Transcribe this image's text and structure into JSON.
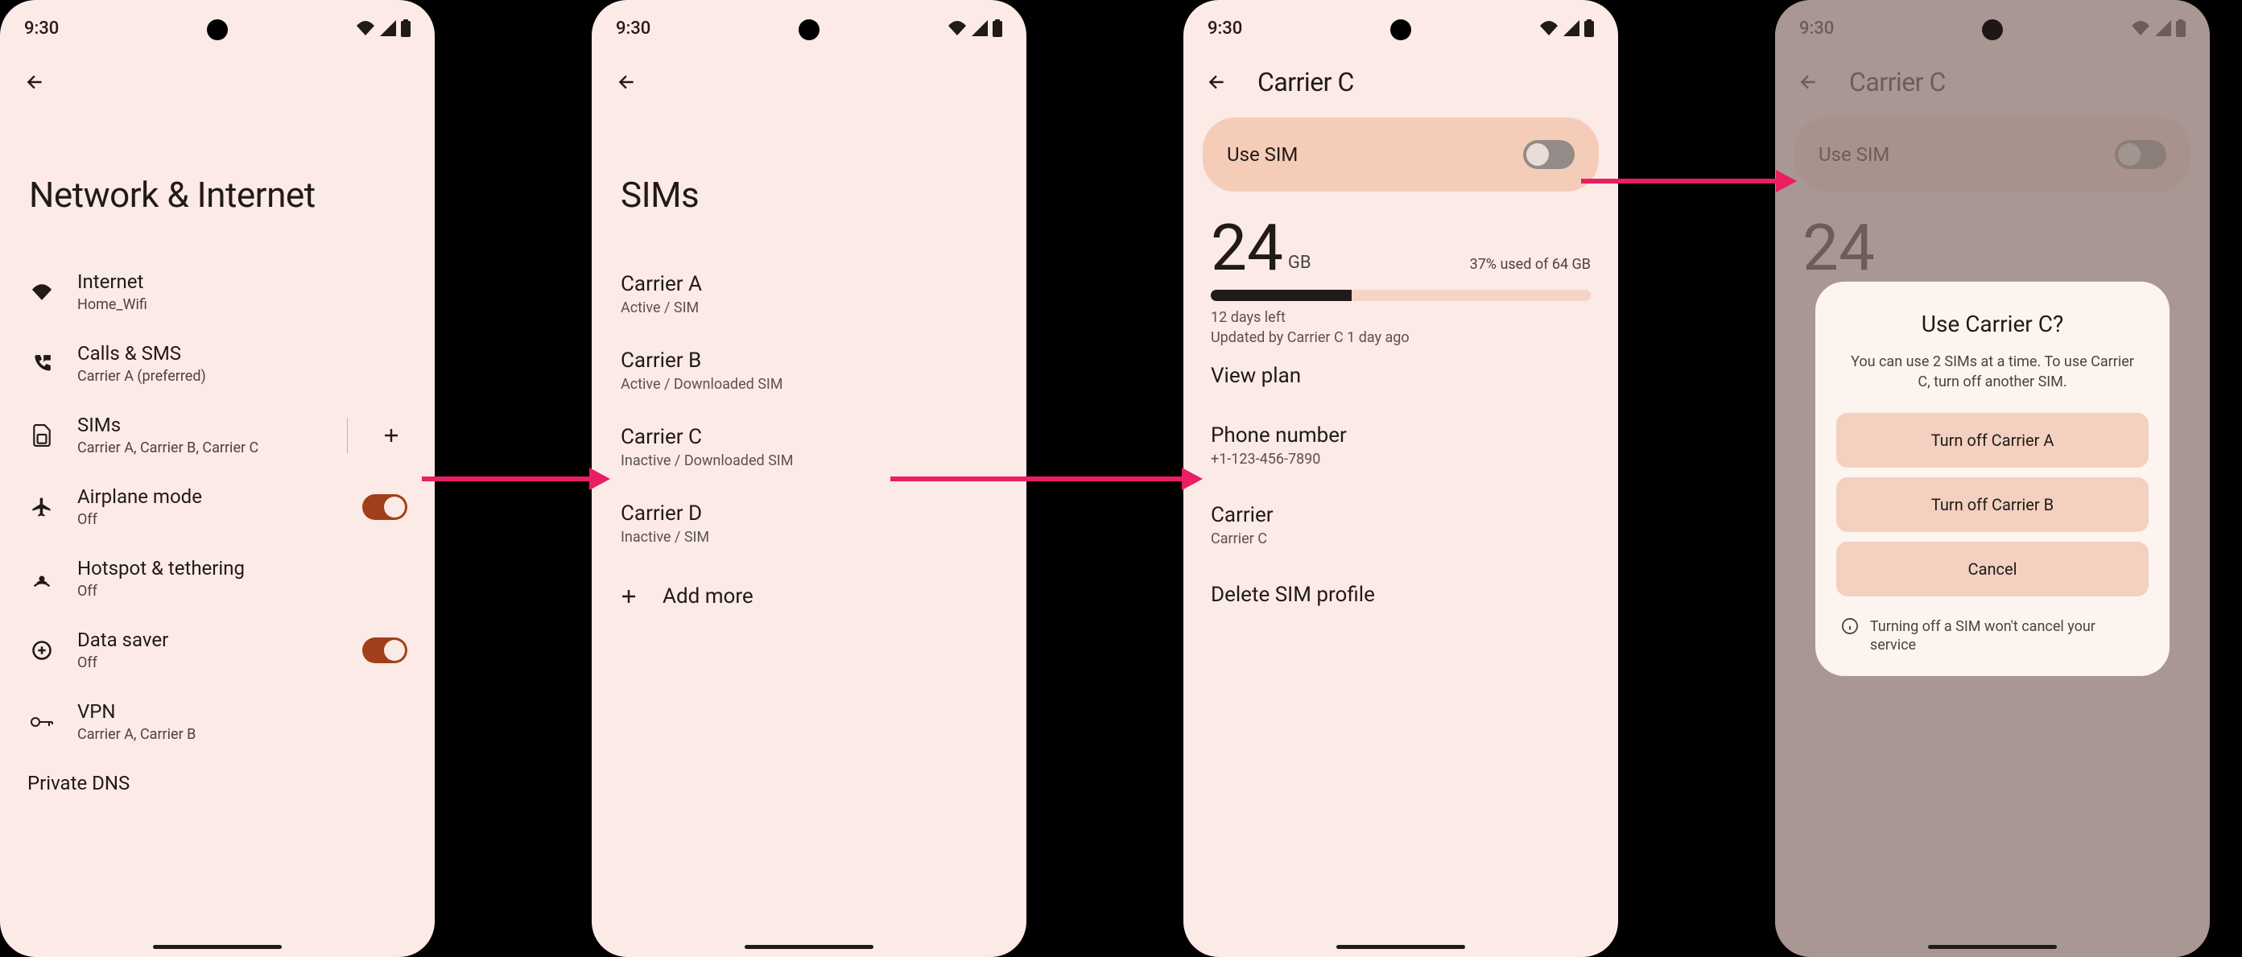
{
  "status": {
    "time": "9:30"
  },
  "screen1": {
    "title": "Network & Internet",
    "internet": {
      "label": "Internet",
      "sub": "Home_Wifi"
    },
    "calls": {
      "label": "Calls & SMS",
      "sub": "Carrier A (preferred)"
    },
    "sims": {
      "label": "SIMs",
      "sub": "Carrier A, Carrier B, Carrier C"
    },
    "airplane": {
      "label": "Airplane mode",
      "sub": "Off"
    },
    "hotspot": {
      "label": "Hotspot & tethering",
      "sub": "Off"
    },
    "datasaver": {
      "label": "Data saver",
      "sub": "Off"
    },
    "vpn": {
      "label": "VPN",
      "sub": "Carrier A, Carrier B"
    },
    "privatedns": {
      "label": "Private DNS"
    }
  },
  "screen2": {
    "title": "SIMs",
    "sims": [
      {
        "name": "Carrier A",
        "status": "Active / SIM"
      },
      {
        "name": "Carrier B",
        "status": "Active / Downloaded SIM"
      },
      {
        "name": "Carrier C",
        "status": "Inactive / Downloaded SIM"
      },
      {
        "name": "Carrier D",
        "status": "Inactive / SIM"
      }
    ],
    "addMore": "Add more"
  },
  "screen3": {
    "title": "Carrier C",
    "useSim": "Use SIM",
    "data": {
      "number": "24",
      "unit": "GB",
      "usedText": "37% used of 64 GB",
      "percent": 37,
      "daysLeft": "12 days left",
      "updated": "Updated by Carrier C 1 day ago"
    },
    "viewPlan": "View plan",
    "phone": {
      "label": "Phone number",
      "value": "+1-123-456-7890"
    },
    "carrier": {
      "label": "Carrier",
      "value": "Carrier C"
    },
    "delete": "Delete SIM profile"
  },
  "screen4": {
    "title": "Carrier C",
    "useSim": "Use SIM",
    "data": {
      "number": "24"
    },
    "dialog": {
      "title": "Use Carrier C?",
      "body": "You can use 2 SIMs at a time. To use Carrier C, turn off another SIM.",
      "turnOffA": "Turn off Carrier A",
      "turnOffB": "Turn off Carrier B",
      "cancel": "Cancel",
      "info": "Turning off a SIM won't cancel your service"
    }
  }
}
